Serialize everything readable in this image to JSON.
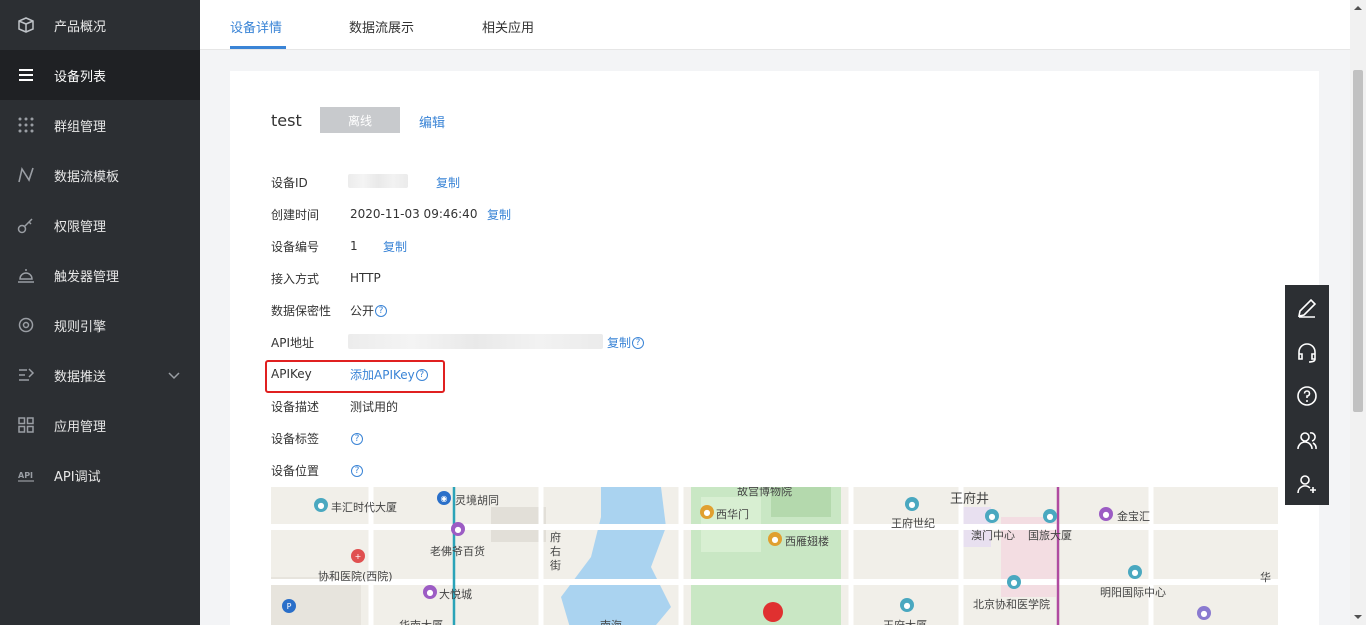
{
  "sidebar": {
    "items": [
      {
        "label": "产品概况",
        "icon": "cube-icon"
      },
      {
        "label": "设备列表",
        "icon": "list-icon"
      },
      {
        "label": "群组管理",
        "icon": "grid-dots-icon"
      },
      {
        "label": "数据流模板",
        "icon": "chart-line-icon"
      },
      {
        "label": "权限管理",
        "icon": "key-icon"
      },
      {
        "label": "触发器管理",
        "icon": "alarm-icon"
      },
      {
        "label": "规则引擎",
        "icon": "target-icon"
      },
      {
        "label": "数据推送",
        "icon": "push-icon"
      },
      {
        "label": "应用管理",
        "icon": "apps-icon"
      },
      {
        "label": "API调试",
        "icon": "api-icon"
      }
    ]
  },
  "tabs": [
    {
      "label": "设备详情"
    },
    {
      "label": "数据流展示"
    },
    {
      "label": "相关应用"
    }
  ],
  "device": {
    "name": "test",
    "status": "离线",
    "edit_label": "编辑",
    "copy_label": "复制",
    "help_glyph": "?",
    "id_label": "设备ID",
    "created_label": "创建时间",
    "created_value": "2020-11-03 09:46:40",
    "number_label": "设备编号",
    "number_value": "1",
    "access_label": "接入方式",
    "access_value": "HTTP",
    "privacy_label": "数据保密性",
    "privacy_value": "公开",
    "api_addr_label": "API地址",
    "apikey_label": "APIKey",
    "apikey_add": "添加APIKey",
    "desc_label": "设备描述",
    "desc_value": "测试用的",
    "tags_label": "设备标签",
    "location_label": "设备位置"
  },
  "map": {
    "labels": [
      "丰汇时代大厦",
      "灵境胡同",
      "老佛爷百货",
      "协和医院(西院)",
      "大悦城",
      "府",
      "右",
      "街",
      "故宫博物院",
      "西华门",
      "西雁翅楼",
      "王府井",
      "王府世纪",
      "澳门中心",
      "国旅大厦",
      "金宝汇",
      "明阳国际中心",
      "北京协和医学院",
      "华",
      "南海",
      "华南大厦",
      "王府大厦"
    ]
  },
  "floatbar": {
    "buttons": [
      "edit-pen-icon",
      "headset-icon",
      "help-circle-icon",
      "users-icon",
      "add-user-icon"
    ]
  },
  "colors": {
    "accent": "#3a84d6",
    "sidebar_bg": "#2c2f33",
    "highlight": "#e02020",
    "status_offline": "#c8cacd"
  }
}
